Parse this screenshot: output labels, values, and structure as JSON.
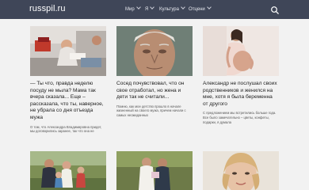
{
  "header": {
    "logo": "russpil.ru",
    "nav": [
      {
        "label": "Мир"
      },
      {
        "label": "Я"
      },
      {
        "label": "Культура"
      },
      {
        "label": "Отцени"
      }
    ]
  },
  "articles": [
    {
      "title": "— Ты что, правда неделю посуду не мыла? Мама так вчера сказала... Еще – рассказала, что ты, наверное, не убрала со дня отъезда мужа",
      "excerpt": "О том, что Александра Владимировна придет, мы договорились заранее, так что она не"
    },
    {
      "title": "Сосед почувствовал, что он свое отработал, но жена и дети так не считали...",
      "excerpt": "Помню, как мое детство прошло в начале жизненный на своего мужа, причем начали с самых неожиданных"
    },
    {
      "title": "Александр не послушал своих родственников и женился на мне, хотя я была беременна от другого",
      "excerpt": "С предложением мы встретились больше года. Все было замечательно – цветы, конфеты, подарки, я думала"
    }
  ]
}
